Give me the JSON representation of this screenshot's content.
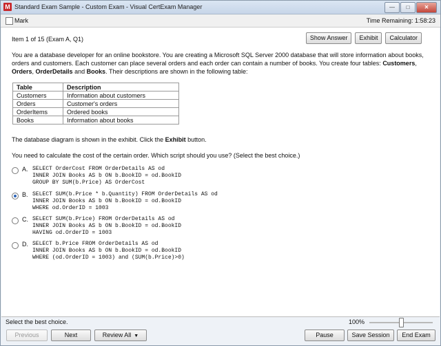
{
  "window": {
    "title": "Standard Exam Sample - Custom Exam - Visual CertExam Manager",
    "icon_letter": "M"
  },
  "markbar": {
    "mark_label": "Mark",
    "time_label": "Time Remaining: 1:58:23"
  },
  "item": {
    "label": "Item 1 of 15  (Exam A, Q1)"
  },
  "toolbar": {
    "show_answer": "Show Answer",
    "exhibit": "Exhibit",
    "calculator": "Calculator"
  },
  "scenario": {
    "text": "You are a database developer for an online bookstore. You are creating a Microsoft SQL Server 2000 database that will store information about books, orders and customers. Each customer can place several orders and each order can contain a number of books. You create four tables: ",
    "t1": "Customers",
    "sep1": ", ",
    "t2": "Orders",
    "sep2": ", ",
    "t3": "OrderDetails",
    "sep3": " and ",
    "t4": "Books",
    "tail": ". Their descriptions are shown in the following table:"
  },
  "table": {
    "headers": [
      "Table",
      "Description"
    ],
    "rows": [
      [
        "Customers",
        "Information about customers"
      ],
      [
        "Orders",
        "Customer's orders"
      ],
      [
        "OrderItems",
        "Ordered books"
      ],
      [
        "Books",
        "Information about books"
      ]
    ]
  },
  "exhibit_line": {
    "pre": "The database diagram is shown in the exhibit. Click the ",
    "bold": "Exhibit",
    "post": " button."
  },
  "question": "You need to calculate the cost of the certain order. Which script should you use? (Select the best choice.)",
  "options": [
    {
      "letter": "A.",
      "selected": false,
      "lines": [
        "SELECT OrderCost FROM OrderDetails AS od",
        "INNER JOIN Books AS b ON b.BookID = od.BookID",
        "GROUP BY SUM(b.Price) AS OrderCost"
      ]
    },
    {
      "letter": "B.",
      "selected": true,
      "lines": [
        "SELECT SUM(b.Price * b.Quantity) FROM OrderDetails AS od",
        "INNER JOIN Books AS b ON b.BookID = od.BookID",
        "WHERE od.OrderID = 1003"
      ]
    },
    {
      "letter": "C.",
      "selected": false,
      "lines": [
        "SELECT SUM(b.Price) FROM OrderDetails AS od",
        "INNER JOIN Books AS b ON b.BookID = od.BookID",
        "HAVING od.OrderID = 1003"
      ]
    },
    {
      "letter": "D.",
      "selected": false,
      "lines": [
        "SELECT b.Price FROM OrderDetails AS od",
        "INNER JOIN Books AS b ON b.BookID = od.BookID",
        "WHERE (od.OrderID = 1003) and (SUM(b.Price)>0)"
      ]
    }
  ],
  "status": {
    "text": "Select the best choice.",
    "zoom": "100%"
  },
  "nav": {
    "previous": "Previous",
    "next": "Next",
    "review_all": "Review All",
    "pause": "Pause",
    "save_session": "Save Session",
    "end_exam": "End Exam"
  }
}
